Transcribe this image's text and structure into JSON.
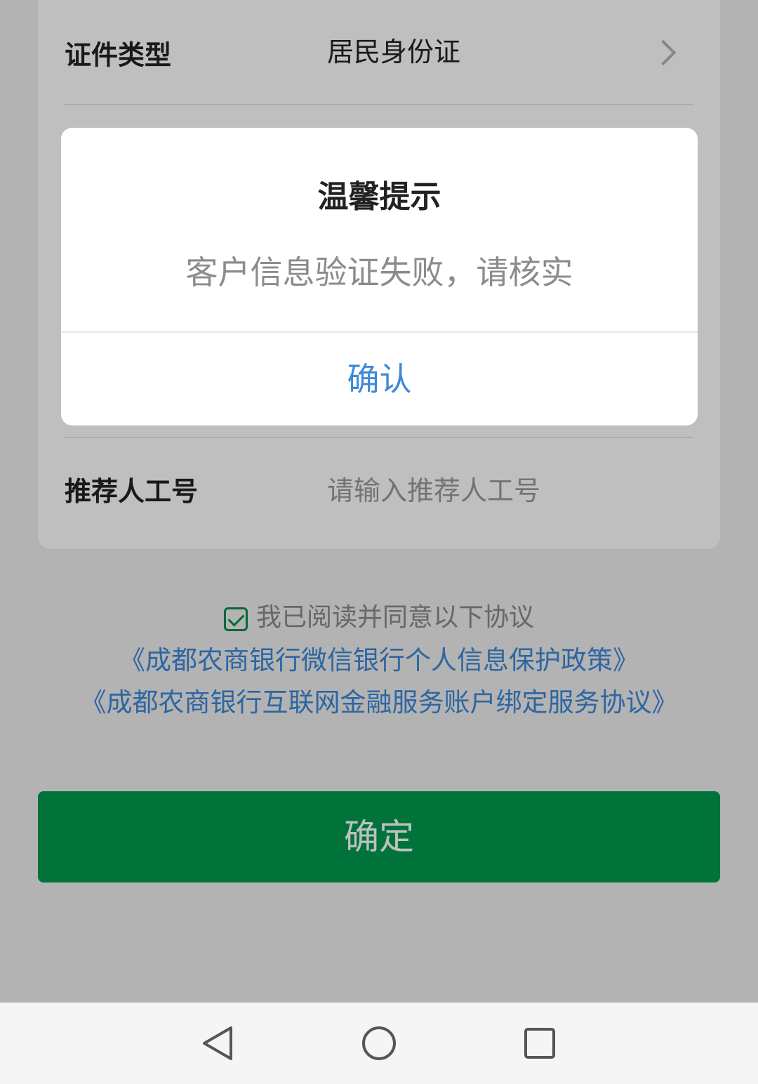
{
  "form": {
    "id_type_label": "证件类型",
    "id_type_value": "居民身份证",
    "referrer_label": "推荐人工号",
    "referrer_placeholder": "请输入推荐人工号"
  },
  "agreement": {
    "checked": true,
    "text": "我已阅读并同意以下协议",
    "links": [
      "《成都农商银行微信银行个人信息保护政策》",
      "《成都农商银行互联网金融服务账户绑定服务协议》"
    ]
  },
  "submit_label": "确定",
  "dialog": {
    "title": "温馨提示",
    "message": "客户信息验证失败，请核实",
    "confirm_label": "确认"
  },
  "colors": {
    "primary": "#009a4f",
    "link": "#3c89d9"
  },
  "icons": {
    "back": "back-triangle-icon",
    "home": "home-circle-icon",
    "recents": "recents-square-icon",
    "chevron": "chevron-right-icon",
    "checkbox": "checkbox-checked-icon"
  }
}
